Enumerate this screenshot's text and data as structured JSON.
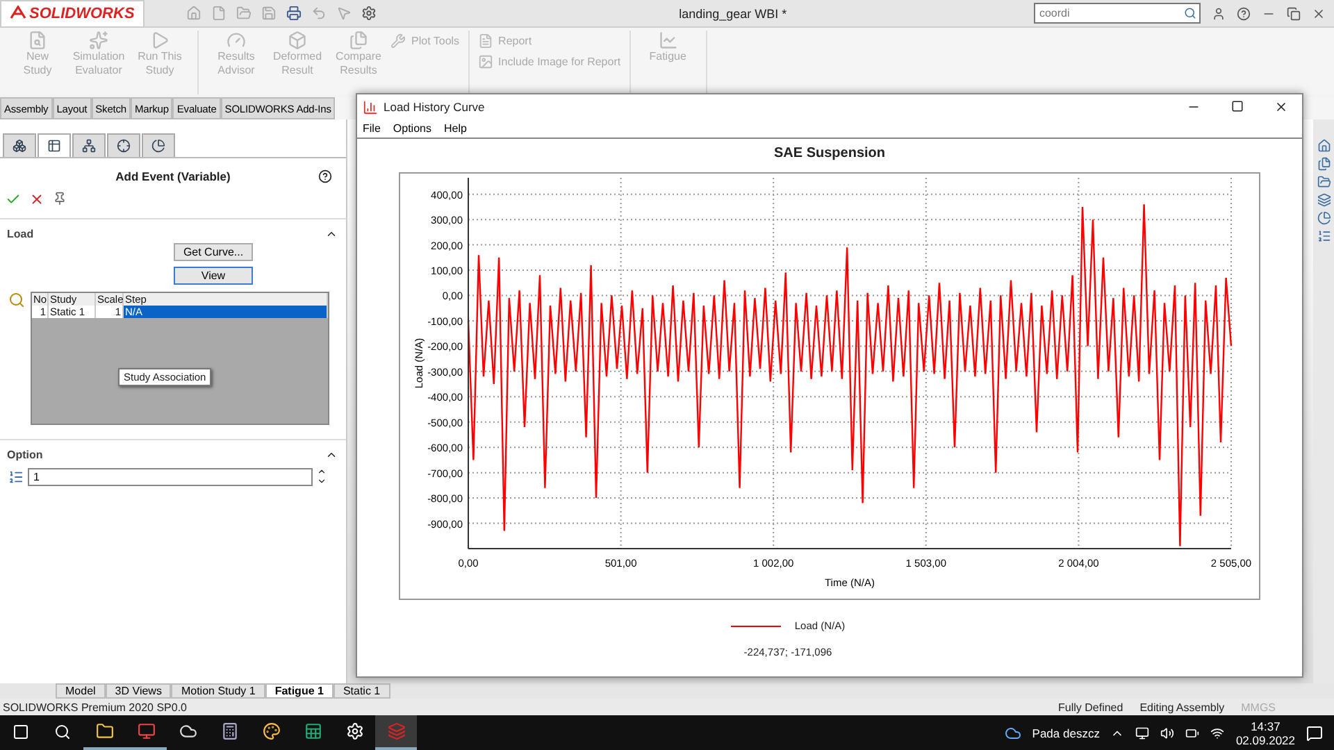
{
  "app": {
    "logo": "SOLIDWORKS",
    "title": "landing_gear WBI *",
    "search": {
      "value": "coordi"
    }
  },
  "ribbon": {
    "groups": [
      {
        "items": [
          {
            "kind": "large",
            "label": "New Study",
            "disabled": true
          },
          {
            "kind": "large",
            "label": "Simulation Evaluator",
            "disabled": true
          },
          {
            "kind": "large",
            "label": "Run This Study",
            "disabled": true
          }
        ]
      },
      {
        "items": [
          {
            "kind": "large",
            "label": "Results Advisor",
            "disabled": true
          },
          {
            "kind": "large",
            "label": "Deformed Result",
            "disabled": true
          },
          {
            "kind": "large",
            "label": "Compare Results",
            "disabled": true
          },
          {
            "kind": "small",
            "label": "Plot Tools",
            "disabled": true
          }
        ]
      },
      {
        "items": [
          {
            "kind": "small",
            "label": "Report",
            "disabled": true
          },
          {
            "kind": "small",
            "label": "Include Image for Report",
            "disabled": true
          }
        ]
      },
      {
        "items": [
          {
            "kind": "large",
            "label": "Fatigue",
            "disabled": true
          }
        ]
      }
    ]
  },
  "command_tabs": [
    "Assembly",
    "Layout",
    "Sketch",
    "Markup",
    "Evaluate",
    "SOLIDWORKS Add-Ins"
  ],
  "property_manager": {
    "tabs": [
      {
        "selected": false
      },
      {
        "selected": true
      },
      {
        "selected": false
      },
      {
        "selected": false
      },
      {
        "selected": false
      }
    ],
    "title": "Add Event (Variable)",
    "load": {
      "heading": "Load",
      "buttons": [
        "Get Curve...",
        "View"
      ],
      "table": {
        "columns": [
          "No",
          "Study",
          "Scale",
          "Step"
        ],
        "rows": [
          {
            "cells": [
              "1",
              "Static 1",
              "1",
              "N/A"
            ],
            "selected": true
          }
        ]
      },
      "tooltip": "Study Association"
    },
    "option": {
      "heading": "Option",
      "value": "1"
    }
  },
  "graph_window": {
    "title": "Load History Curve",
    "menu": [
      "File",
      "Options",
      "Help"
    ],
    "chart_data": {
      "type": "line",
      "title": "SAE Suspension",
      "xlabel": "Time (N/A)",
      "ylabel": "Load (N/A)",
      "grid": true,
      "xlim": [
        0,
        2505
      ],
      "ylim": [
        -1000,
        465
      ],
      "x": [
        0,
        17,
        34,
        50,
        67,
        84,
        101,
        118,
        134,
        151,
        168,
        185,
        202,
        219,
        235,
        252,
        269,
        286,
        303,
        319,
        336,
        353,
        370,
        387,
        403,
        420,
        437,
        454,
        471,
        488,
        504,
        521,
        538,
        555,
        572,
        588,
        605,
        622,
        639,
        656,
        672,
        689,
        706,
        723,
        740,
        757,
        773,
        790,
        807,
        824,
        841,
        857,
        874,
        891,
        908,
        925,
        941,
        958,
        975,
        992,
        1009,
        1026,
        1042,
        1059,
        1076,
        1093,
        1110,
        1126,
        1143,
        1160,
        1177,
        1194,
        1210,
        1227,
        1244,
        1261,
        1278,
        1295,
        1311,
        1328,
        1345,
        1362,
        1379,
        1395,
        1412,
        1429,
        1446,
        1463,
        1479,
        1496,
        1513,
        1530,
        1547,
        1564,
        1580,
        1597,
        1614,
        1631,
        1648,
        1664,
        1681,
        1698,
        1715,
        1732,
        1748,
        1765,
        1782,
        1799,
        1816,
        1833,
        1849,
        1866,
        1883,
        1900,
        1917,
        1933,
        1950,
        1967,
        1984,
        2001,
        2017,
        2034,
        2051,
        2068,
        2085,
        2102,
        2118,
        2135,
        2152,
        2169,
        2186,
        2202,
        2219,
        2236,
        2253,
        2270,
        2286,
        2303,
        2320,
        2337,
        2354,
        2371,
        2387,
        2404,
        2421,
        2438,
        2455,
        2471,
        2488,
        2505
      ],
      "xticks": [
        {
          "value": 0,
          "label": "0,00"
        },
        {
          "value": 501,
          "label": "501,00"
        },
        {
          "value": 1002,
          "label": "1 002,00"
        },
        {
          "value": 1503,
          "label": "1 503,00"
        },
        {
          "value": 2004,
          "label": "2 004,00"
        },
        {
          "value": 2505,
          "label": "2 505,00"
        }
      ],
      "yticks": [
        {
          "value": 400,
          "label": "400,00"
        },
        {
          "value": 300,
          "label": "300,00"
        },
        {
          "value": 200,
          "label": "200,00"
        },
        {
          "value": 100,
          "label": "100,00"
        },
        {
          "value": 0,
          "label": "0,00"
        },
        {
          "value": -100,
          "label": "-100,00"
        },
        {
          "value": -200,
          "label": "-200,00"
        },
        {
          "value": -300,
          "label": "-300,00"
        },
        {
          "value": -400,
          "label": "-400,00"
        },
        {
          "value": -500,
          "label": "-500,00"
        },
        {
          "value": -600,
          "label": "-600,00"
        },
        {
          "value": -700,
          "label": "-700,00"
        },
        {
          "value": -800,
          "label": "-800,00"
        },
        {
          "value": -900,
          "label": "-900,00"
        }
      ],
      "series": [
        {
          "name": "Load (N/A)",
          "color": "#ff0000",
          "values": [
            -100,
            -650,
            160,
            -320,
            -20,
            -350,
            150,
            -930,
            -10,
            -300,
            20,
            -520,
            -30,
            -330,
            80,
            -760,
            -40,
            -310,
            30,
            -340,
            -20,
            -300,
            10,
            -560,
            120,
            -800,
            -30,
            -320,
            0,
            -290,
            -40,
            -330,
            20,
            -310,
            -50,
            -700,
            0,
            -300,
            -30,
            -320,
            40,
            -340,
            -20,
            -300,
            10,
            -600,
            -40,
            -310,
            0,
            -330,
            60,
            -300,
            -30,
            -760,
            20,
            -320,
            -10,
            -290,
            30,
            -340,
            -20,
            -310,
            90,
            -620,
            -30,
            -300,
            10,
            -330,
            -40,
            -320,
            0,
            -300,
            20,
            -330,
            190,
            -690,
            -20,
            -820,
            10,
            -310,
            -30,
            -300,
            40,
            -340,
            -10,
            -320,
            20,
            -760,
            -30,
            -300,
            0,
            -310,
            50,
            -330,
            -20,
            -600,
            10,
            -300,
            -40,
            -320,
            30,
            -310,
            -20,
            -700,
            0,
            -330,
            60,
            -300,
            -30,
            -320,
            10,
            -540,
            -40,
            -310,
            20,
            -330,
            0,
            -300,
            80,
            -620,
            350,
            -200,
            300,
            -330,
            150,
            -300,
            -10,
            -560,
            30,
            -320,
            0,
            -340,
            360,
            -310,
            20,
            -650,
            -30,
            -300,
            40,
            -990,
            0,
            -520,
            50,
            -870,
            -20,
            -310,
            40,
            -580,
            70,
            -200
          ]
        }
      ]
    },
    "readout": "-224,737; -171,096"
  },
  "bottom_tabs": [
    {
      "label": "Model",
      "selected": false
    },
    {
      "label": "3D Views",
      "selected": false
    },
    {
      "label": "Motion Study 1",
      "selected": false
    },
    {
      "label": "Fatigue 1",
      "selected": true
    },
    {
      "label": "Static 1",
      "selected": false
    }
  ],
  "status_bar": {
    "product": "SOLIDWORKS Premium 2020 SP0.0",
    "items": [
      {
        "text": "Fully Defined",
        "disabled": false
      },
      {
        "text": "Editing Assembly",
        "disabled": false
      },
      {
        "text": "MMGS",
        "disabled": true
      }
    ]
  },
  "taskbar": {
    "apps": [
      {
        "open": true,
        "active": false
      },
      {
        "open": true,
        "active": false
      },
      {
        "open": false,
        "active": false
      },
      {
        "open": false,
        "active": false
      },
      {
        "open": false,
        "active": false
      },
      {
        "open": false,
        "active": false
      },
      {
        "open": false,
        "active": false
      },
      {
        "open": true,
        "active": true
      }
    ],
    "weather": "Pada deszcz",
    "time": "14:37",
    "date": "02.09.2022"
  }
}
